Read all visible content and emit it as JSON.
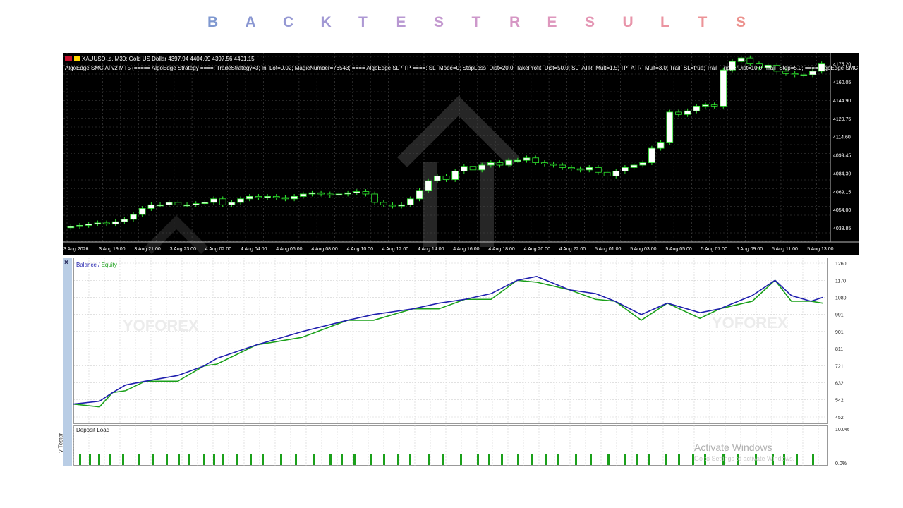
{
  "banner": {
    "letters": [
      "B",
      "A",
      "C",
      "K",
      "T",
      "E",
      "S",
      "T",
      "R",
      "E",
      "S",
      "U",
      "L",
      "T",
      "S"
    ],
    "colors": [
      "#7f98d0",
      "#8a97d2",
      "#9598d3",
      "#a198d4",
      "#ad98d4",
      "#b898d2",
      "#c398cf",
      "#cd98cb",
      "#d697c4",
      "#de97bd",
      "#e496b4",
      "#e895aa",
      "#eb94a0",
      "#ec9397",
      "#ec928e"
    ]
  },
  "chart": {
    "symbol_line": "XAUUSD-,s, M30:  Gold US Dollar  4397.94 4404.09 4397.56 4401.15",
    "params_line": "AlgoEdge SMC AI v2 MT5 (===== AlgoEdge Strategy ====: TradeStrategy=3; In_Lot=0.02; MagicNumber=76543; ==== AlgoEdge SL / TP ====: SL_Mode=0; StopLoss_Dist=20.0; TakeProfit_Dist=50.0; SL_ATR_Mult=1.5; TP_ATR_Mult=3.0; Trail_SL=true; Trail_TriggerDist=10.0; Trail_Step=5.0; ==== AlgoEdge SMC Pa",
    "price_ticks": [
      "4175.20",
      "4160.05",
      "4144.90",
      "4129.75",
      "4114.60",
      "4099.45",
      "4084.30",
      "4069.15",
      "4054.00",
      "4038.85"
    ],
    "time_ticks": [
      "3 Aug 2026",
      "3 Aug 19:00",
      "3 Aug 21:00",
      "3 Aug 23:00",
      "4 Aug 02:00",
      "4 Aug 04:00",
      "4 Aug 06:00",
      "4 Aug 08:00",
      "4 Aug 10:00",
      "4 Aug 12:00",
      "4 Aug 14:00",
      "4 Aug 16:00",
      "4 Aug 18:00",
      "4 Aug 20:00",
      "4 Aug 22:00",
      "5 Aug 01:00",
      "5 Aug 03:00",
      "5 Aug 05:00",
      "5 Aug 07:00",
      "5 Aug 09:00",
      "5 Aug 11:00",
      "5 Aug 13:00"
    ],
    "colors": {
      "background": "#000000",
      "bull": "#ffffff",
      "bear": "#000000",
      "wick": "#2ee82e",
      "grid": "#4a4a4a",
      "text": "#ffffff"
    }
  },
  "tester": {
    "close_label": "×",
    "tester_label": "y Tester",
    "balance_label": "Balance",
    "separator": " / ",
    "equity_label": "Equity",
    "deposit_label": "Deposit Load",
    "y_ticks": [
      "1260",
      "1170",
      "1080",
      "991",
      "901",
      "811",
      "721",
      "632",
      "542",
      "452"
    ],
    "deposit_ticks": [
      "10.0%",
      "0.0%"
    ],
    "colors": {
      "balance": "#1f1fae",
      "equity": "#1aa01a",
      "grid": "#d0d0d0",
      "bars": "#1aa01a"
    }
  },
  "watermark": {
    "text": "YOFOREX"
  },
  "overlay": {
    "activate_title": "Activate Windows",
    "activate_sub": "Go to Settings to activate Windows."
  }
}
